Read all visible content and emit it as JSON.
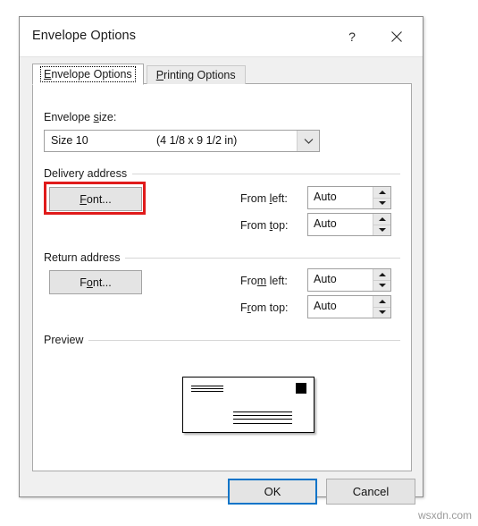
{
  "window": {
    "title": "Envelope Options",
    "help_icon": "question-mark-icon",
    "close_icon": "close-x-icon"
  },
  "tabs": [
    {
      "label": "Envelope Options",
      "accel": "E",
      "active": true
    },
    {
      "label": "Printing Options",
      "accel": "P",
      "active": false
    }
  ],
  "envelope_size": {
    "label_before": "Envelope ",
    "label_accel": "s",
    "label_after": "ize:",
    "value_name": "Size 10",
    "value_dimensions": "(4 1/8 x 9 1/2 in)",
    "dropdown_icon": "chevron-down-icon"
  },
  "delivery_address": {
    "group_label": "Delivery address",
    "font_button": {
      "accel": "F",
      "rest": "ont...",
      "highlighted": true
    },
    "from_left": {
      "label_before": "From ",
      "label_accel": "l",
      "label_after": "eft:",
      "value": "Auto"
    },
    "from_top": {
      "label_before": "From ",
      "label_accel": "t",
      "label_after": "op:",
      "value": "Auto"
    }
  },
  "return_address": {
    "group_label": "Return address",
    "font_button": {
      "before": "F",
      "accel": "o",
      "rest": "nt...",
      "highlighted": false
    },
    "from_left": {
      "label_before": "Fro",
      "label_accel": "m",
      "label_after": " left:",
      "value": "Auto"
    },
    "from_top": {
      "label_before": "F",
      "label_accel": "r",
      "label_after": "om top:",
      "value": "Auto"
    }
  },
  "preview": {
    "group_label": "Preview",
    "stamp_icon": "stamp-square-icon",
    "return_address_lines": 3,
    "delivery_address_lines": 4
  },
  "footer": {
    "ok_label": "OK",
    "cancel_label": "Cancel"
  },
  "watermark": "wsxdn.com",
  "colors": {
    "highlight": "#e01b1b",
    "focus": "#0a74c8",
    "dialog_bg": "#f0f0f0",
    "panel_bg": "#ffffff"
  }
}
